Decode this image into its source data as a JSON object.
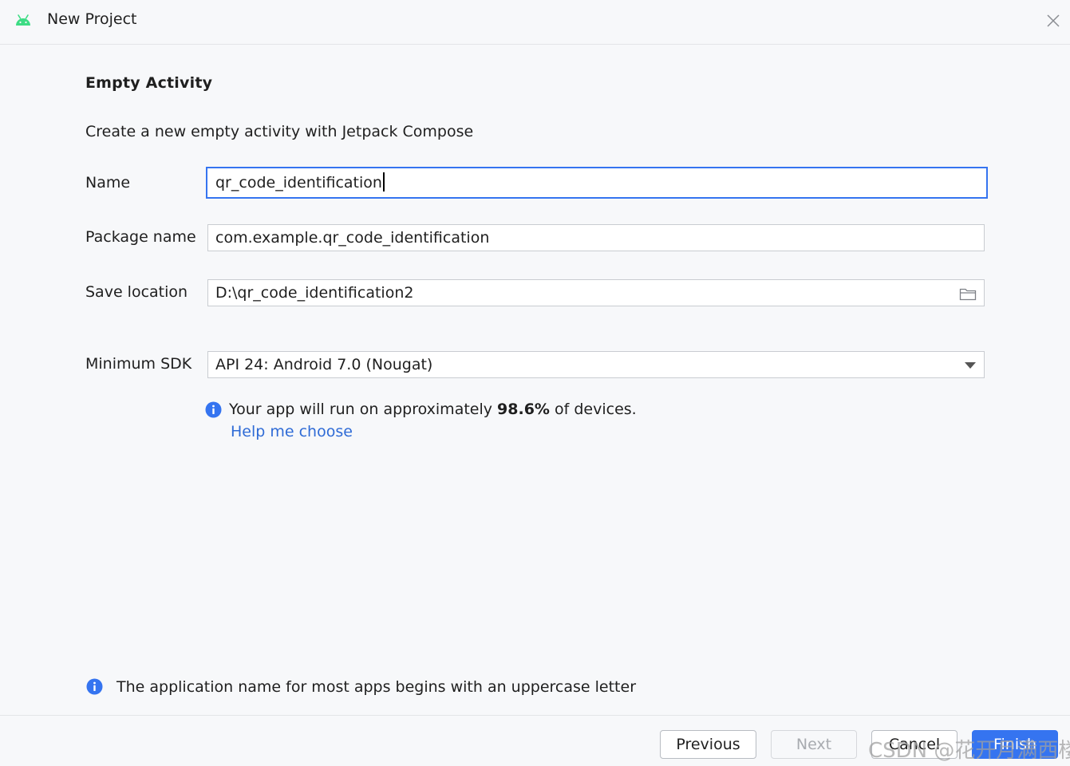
{
  "window": {
    "title": "New Project"
  },
  "template": {
    "heading": "Empty Activity",
    "description": "Create a new empty activity with Jetpack Compose"
  },
  "form": {
    "name": {
      "label": "Name",
      "value": "qr_code_identification"
    },
    "package": {
      "label": "Package name",
      "value": "com.example.qr_code_identification"
    },
    "save_location": {
      "label": "Save location",
      "value": "D:\\qr_code_identification2"
    },
    "min_sdk": {
      "label": "Minimum SDK",
      "value": "API 24: Android 7.0 (Nougat)"
    }
  },
  "sdk_info": {
    "prefix": "Your app will run on approximately ",
    "percent": "98.6%",
    "suffix": " of devices.",
    "help_link": "Help me choose"
  },
  "hint": {
    "text": "The application name for most apps begins with an uppercase letter"
  },
  "buttons": {
    "previous": "Previous",
    "next": "Next",
    "cancel": "Cancel",
    "finish": "Finish"
  },
  "watermark": "CSDN @花开月满西楼",
  "colors": {
    "accent": "#3574f0",
    "link": "#2f6bd6",
    "android_green": "#3ddc84",
    "info_blue": "#3574f0"
  },
  "icons": {
    "app": "android-icon",
    "close": "close-icon",
    "folder": "folder-icon",
    "dropdown": "chevron-down-icon",
    "info": "info-icon"
  }
}
